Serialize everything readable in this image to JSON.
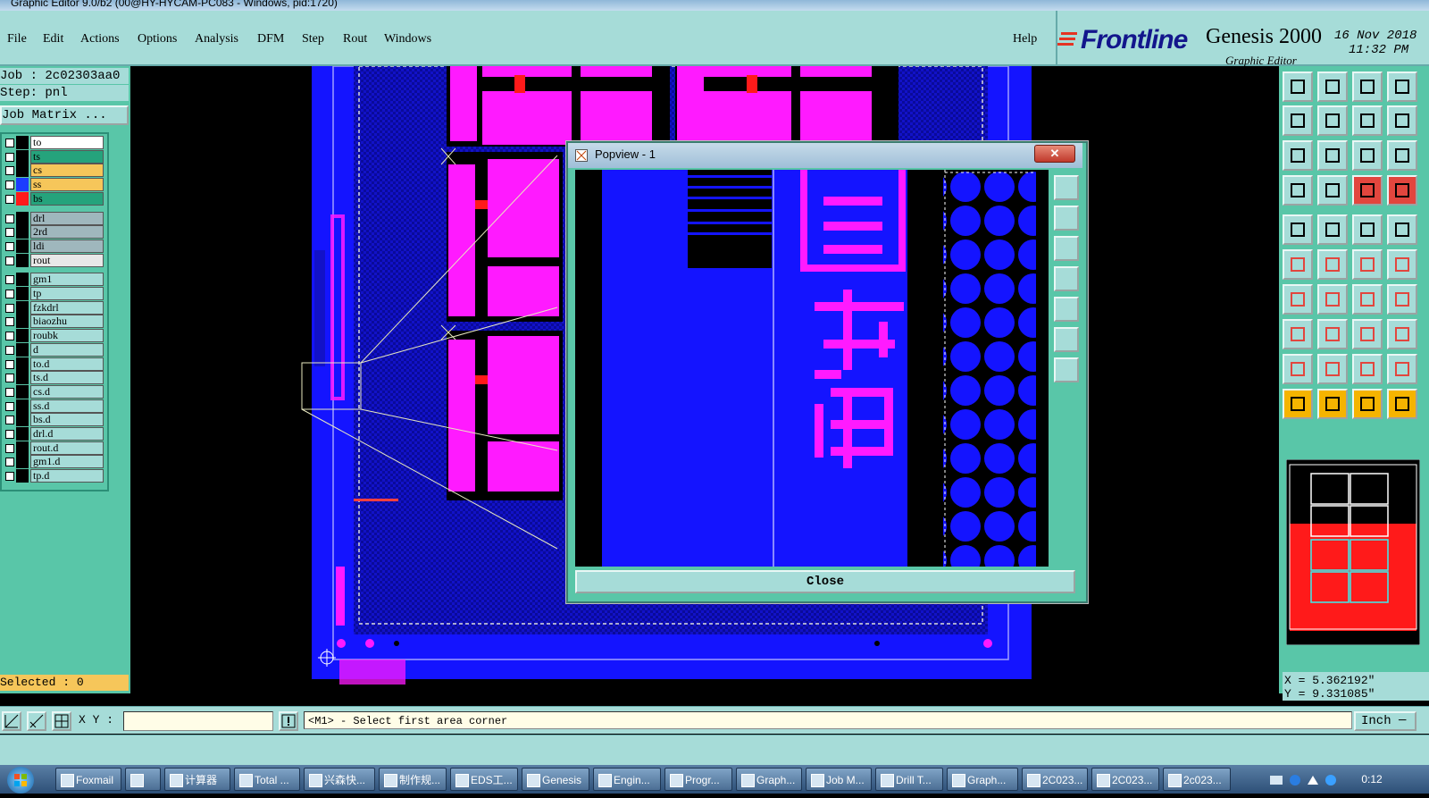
{
  "window_title": "Graphic Editor 9.0/b2 (00@HY-HYCAM-PC083 - Windows, pid:1720)",
  "menu": [
    "File",
    "Edit",
    "Actions",
    "Options",
    "Analysis",
    "DFM",
    "Step",
    "Rout",
    "Windows"
  ],
  "help_label": "Help",
  "brand": {
    "logo": "Frontline",
    "product": "Genesis 2000",
    "subtitle": "Graphic Editor",
    "date": "16 Nov 2018",
    "time": "11:32 PM"
  },
  "job": {
    "label": "Job : 2c02303aa0",
    "step": "Step: pnl",
    "matrix_button": "Job Matrix ..."
  },
  "layers": [
    {
      "name": "to",
      "bg": "#ffffff",
      "color": "#000000"
    },
    {
      "name": "ts",
      "bg": "#25a37c",
      "color": "#000000"
    },
    {
      "name": "cs",
      "bg": "#f6c65a",
      "color": "#000000"
    },
    {
      "name": "ss",
      "bg": "#f6c65a",
      "color": "#1c3cff"
    },
    {
      "name": "bs",
      "bg": "#25a37c",
      "color": "#ff1a1a"
    },
    {
      "name": "drl",
      "bg": "#9fb7bd",
      "color": "#000000"
    },
    {
      "name": "2rd",
      "bg": "#9fb7bd",
      "color": "#000000"
    },
    {
      "name": "ldi",
      "bg": "#9fb7bd",
      "color": "#000000"
    },
    {
      "name": "rout",
      "bg": "#e8e8e8",
      "color": "#000000"
    },
    {
      "name": "gm1",
      "bg": "#a6dcd8",
      "color": "#000000"
    },
    {
      "name": "tp",
      "bg": "#a6dcd8",
      "color": "#000000"
    },
    {
      "name": "fzkdrl",
      "bg": "#a6dcd8",
      "color": "#000000"
    },
    {
      "name": "biaozhu",
      "bg": "#a6dcd8",
      "color": "#000000"
    },
    {
      "name": "roubk",
      "bg": "#a6dcd8",
      "color": "#000000"
    },
    {
      "name": "d",
      "bg": "#a6dcd8",
      "color": "#000000"
    },
    {
      "name": "to.d",
      "bg": "#a6dcd8",
      "color": "#000000"
    },
    {
      "name": "ts.d",
      "bg": "#a6dcd8",
      "color": "#000000"
    },
    {
      "name": "cs.d",
      "bg": "#a6dcd8",
      "color": "#000000"
    },
    {
      "name": "ss.d",
      "bg": "#a6dcd8",
      "color": "#000000"
    },
    {
      "name": "bs.d",
      "bg": "#a6dcd8",
      "color": "#000000"
    },
    {
      "name": "drl.d",
      "bg": "#a6dcd8",
      "color": "#000000"
    },
    {
      "name": "rout.d",
      "bg": "#a6dcd8",
      "color": "#000000"
    },
    {
      "name": "gm1.d",
      "bg": "#a6dcd8",
      "color": "#000000"
    },
    {
      "name": "tp.d",
      "bg": "#a6dcd8",
      "color": "#000000"
    }
  ],
  "selected_label": "Selected : 0",
  "popview": {
    "title": "Popview - 1",
    "close_label": "Close",
    "close_x": "✕"
  },
  "coords": {
    "x": "X = 5.362192\"",
    "y": "Y = 9.331085\""
  },
  "status": {
    "xy_label": "X Y :",
    "xy_value": "",
    "prompt": "<M1> - Select first area corner",
    "unit": "Inch ─"
  },
  "taskbar": {
    "items": [
      "Foxmail",
      "",
      "计算器",
      "Total ...",
      "兴森快...",
      "制作规...",
      "EDS工...",
      "Genesis",
      "Engin...",
      "Progr...",
      "Graph...",
      "Job M...",
      "Drill T...",
      "Graph...",
      "2C023...",
      "2C023...",
      "2c023..."
    ],
    "clock": "0:12"
  },
  "colors": {
    "board_blue": "#1414ff",
    "pad_magenta": "#ff1aff",
    "trace_red": "#ff1a1a",
    "panel_teal": "#59c6a8",
    "panel_light": "#a6dcd8"
  }
}
